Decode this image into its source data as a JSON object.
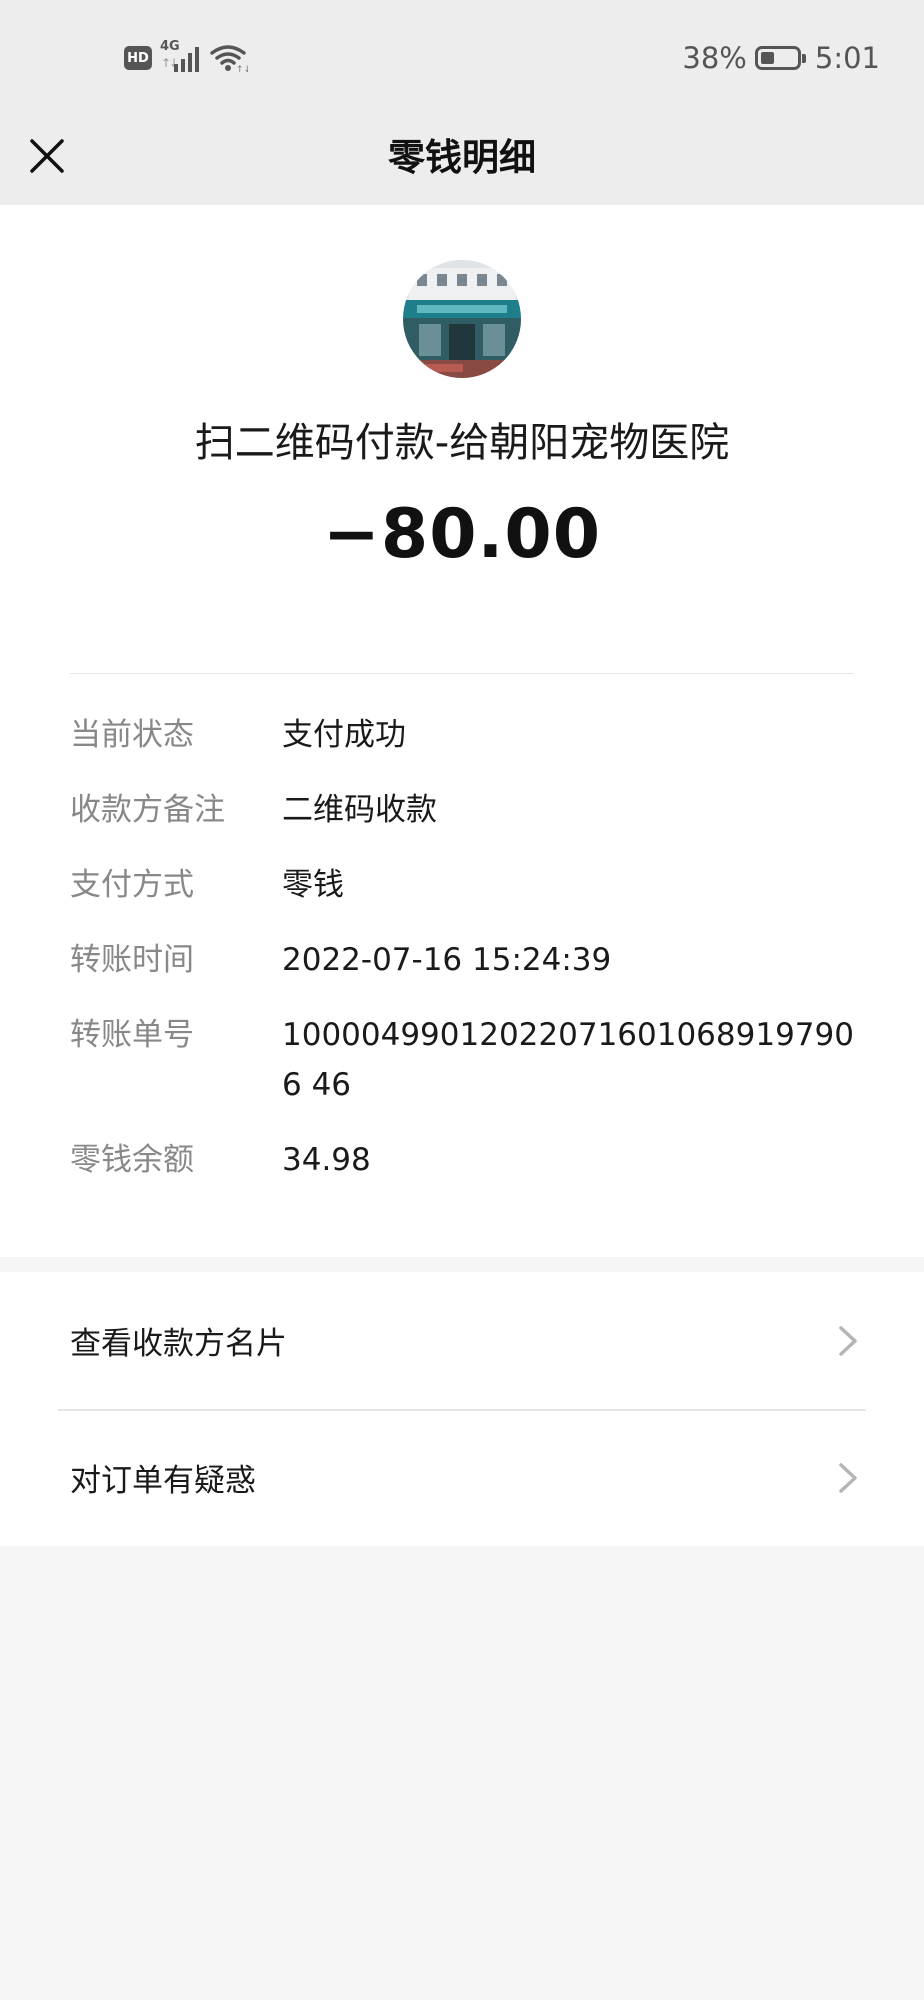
{
  "status_bar": {
    "hd": "HD",
    "network": "4G",
    "network_arrows": "↑↓",
    "battery_percent_text": "38%",
    "battery_level": 0.38,
    "time": "5:01"
  },
  "nav": {
    "title": "零钱明细",
    "close_icon": "close-icon"
  },
  "transaction": {
    "merchant_title": "扫二维码付款-给朝阳宠物医院",
    "amount": "−80.00"
  },
  "details": [
    {
      "label": "当前状态",
      "value": "支付成功"
    },
    {
      "label": "收款方备注",
      "value": "二维码收款"
    },
    {
      "label": "支付方式",
      "value": "零钱"
    },
    {
      "label": "转账时间",
      "value": "2022-07-16 15:24:39"
    },
    {
      "label": "转账单号",
      "value": "100004990120220716010689197906 46"
    },
    {
      "label": "零钱余额",
      "value": "34.98"
    }
  ],
  "menu": [
    {
      "label": "查看收款方名片",
      "icon": "chevron-right-icon"
    },
    {
      "label": "对订单有疑惑",
      "icon": "chevron-right-icon"
    }
  ],
  "colors": {
    "header_bg": "#ededed",
    "page_bg": "#f5f5f5",
    "card_bg": "#ffffff",
    "label_gray": "#888888",
    "text": "#1a1a1a"
  }
}
